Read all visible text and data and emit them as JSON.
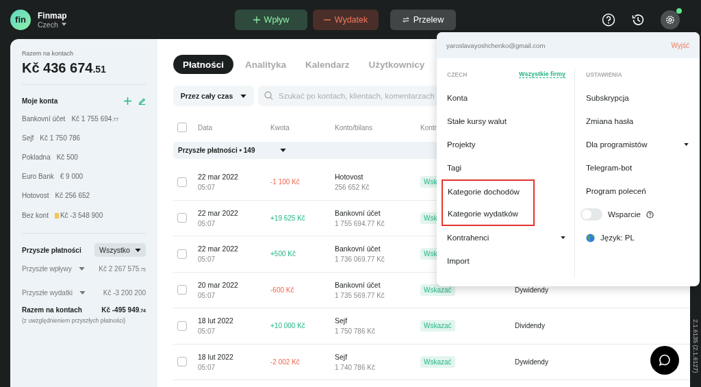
{
  "app": {
    "logo": "fin",
    "name": "Finmap",
    "company": "Czech"
  },
  "actions": [
    {
      "kind": "income",
      "label": "Wpływ"
    },
    {
      "kind": "expense",
      "label": "Wydatek"
    },
    {
      "kind": "transfer",
      "label": "Przelew"
    }
  ],
  "settings_badge": true,
  "sidebar": {
    "total_label": "Razem na kontach",
    "total": "Kč 436 674",
    "total_cents": ".51",
    "accounts_title": "Moje konta",
    "accounts": [
      {
        "name": "Bankovní účet",
        "amount": "Kč 1 755 694",
        "cents": ".77"
      },
      {
        "name": "Sejf",
        "amount": "Kč 1 750 786"
      },
      {
        "name": "Pokladna",
        "amount": "Kč 500"
      },
      {
        "name": "Euro Bank",
        "amount": "€ 9 000"
      },
      {
        "name": "Hotovost",
        "amount": "Kč 256 652"
      },
      {
        "name": "Bez kont",
        "amount": "Kč -3 548 900",
        "warning": true
      }
    ],
    "future_title": "Przyszłe płatności",
    "future_filter": "Wszystko",
    "future": [
      {
        "name": "Przyszłe wpływy",
        "amount": "Kč 2 267 575",
        "cents": ".75"
      },
      {
        "name": "Przyszłe wydatki",
        "amount": "Kč -3 200 200"
      }
    ],
    "sum_label": "Razem na kontach",
    "sum": "Kč -495 949",
    "sum_cents": ".74",
    "sum_note": "(z uwzględnieniem przyszłych płatności)"
  },
  "tabs": [
    {
      "label": "Płatności",
      "selected": true
    },
    {
      "label": "Analityka",
      "selected": false
    },
    {
      "label": "Kalendarz",
      "selected": false
    },
    {
      "label": "Użytkownicy",
      "selected": false
    }
  ],
  "filters": {
    "period": "Przez cały czas",
    "search_placeholder": "Szukać po kontach, klientach, komentarzach"
  },
  "table": {
    "all_checked": false,
    "columns": [
      "Data",
      "Kwota",
      "Konto/bilans",
      "Kontr"
    ],
    "group": "Przyszłe płatności • 149",
    "rows": [
      {
        "date": "22 mar 2022",
        "time": "05:07",
        "kind": "expense",
        "amount": "-1 100 Kč",
        "account": "Hotovost",
        "balance": "256 652 Kč",
        "tag": "Wsk",
        "checked": false
      },
      {
        "date": "22 mar 2022",
        "time": "05:07",
        "kind": "income",
        "amount": "+19 625 Kč",
        "account": "Bankovní účet",
        "balance": "1 755 694.77 Kč",
        "tag": "Wsk",
        "checked": false
      },
      {
        "date": "22 mar 2022",
        "time": "05:07",
        "kind": "income",
        "amount": "+500 Kč",
        "account": "Bankovní účet",
        "balance": "1 736 069.77 Kč",
        "tag": "Wsk",
        "checked": false
      },
      {
        "date": "20 mar 2022",
        "time": "05:07",
        "kind": "expense",
        "amount": "-600 Kč",
        "account": "Bankovní účet",
        "balance": "1 735 569.77 Kč",
        "tag": "Wskazać",
        "category": "Dywidendy",
        "checked": false
      },
      {
        "date": "18 lut 2022",
        "time": "05:07",
        "kind": "income",
        "amount": "+10 000 Kč",
        "account": "Sejf",
        "balance": "1 750 786 Kč",
        "tag": "Wskazać",
        "category": "Dividendy",
        "checked": false
      },
      {
        "date": "18 lut 2022",
        "time": "05:07",
        "kind": "expense",
        "amount": "-2 002 Kč",
        "account": "Sejf",
        "balance": "1 740 786 Kč",
        "tag": "Wskazać",
        "category": "Dywidendy",
        "checked": false
      }
    ]
  },
  "menu": {
    "email": "yaroslavayoshchenko@gmail.com",
    "logout": "Wyjść",
    "left_title": "CZECH",
    "left_link": "Wszystkie firmy",
    "right_title": "USTAWIENIA",
    "left": [
      {
        "kind": "link",
        "label": "Konta",
        "highlighted": false
      },
      {
        "kind": "link",
        "label": "Stałe kursy walut",
        "highlighted": false
      },
      {
        "kind": "link",
        "label": "Projekty",
        "highlighted": false
      },
      {
        "kind": "link",
        "label": "Tagi",
        "highlighted": false
      },
      {
        "kind": "link",
        "label": "Kategorie dochodów",
        "highlighted": true
      },
      {
        "kind": "link",
        "label": "Kategorie wydatków",
        "highlighted": true
      },
      {
        "kind": "expandable",
        "label": "Kontrahenci",
        "highlighted": false
      },
      {
        "kind": "link",
        "label": "Import",
        "highlighted": false
      }
    ],
    "right": [
      {
        "kind": "link",
        "label": "Subskrypcja"
      },
      {
        "kind": "link",
        "label": "Zmiana hasła"
      },
      {
        "kind": "expandable",
        "label": "Dla programistów"
      },
      {
        "kind": "link",
        "label": "Telegram-bot"
      },
      {
        "kind": "link",
        "label": "Program poleceń"
      },
      {
        "kind": "toggle",
        "label": "Wsparcie",
        "on": false
      },
      {
        "kind": "language",
        "label": "Język: PL"
      }
    ]
  },
  "version": "2.1.6135 (2.1.6127)"
}
